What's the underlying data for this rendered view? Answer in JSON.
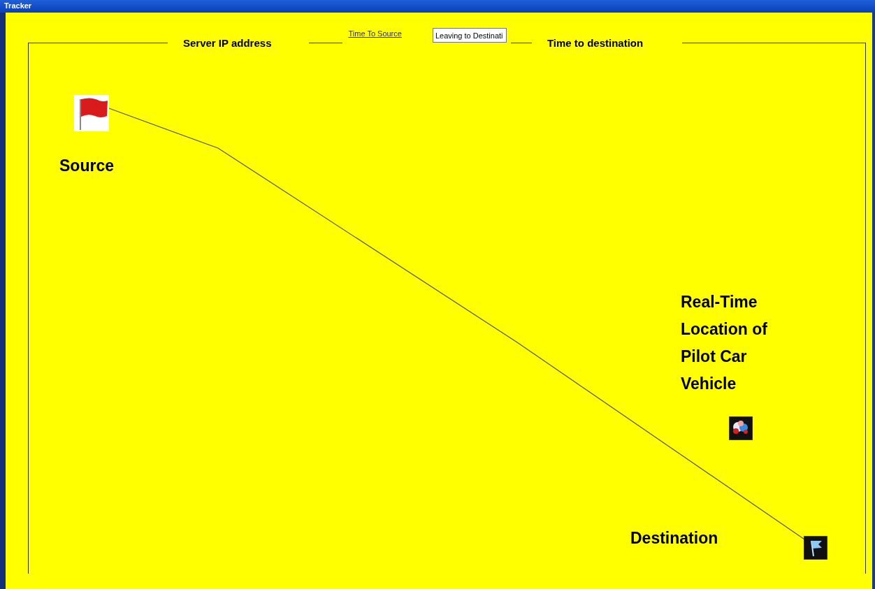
{
  "window": {
    "title": "Tracker"
  },
  "header": {
    "server_label": "Server IP address",
    "time_to_source_link": "Time To Source",
    "status_field": {
      "value": "Leaving to Destinati"
    },
    "time_to_destination_label": "Time to destination"
  },
  "map": {
    "markers": [
      {
        "kind": "source",
        "label": "Source"
      },
      {
        "kind": "vehicle",
        "label": "Real-Time Location of Pilot Car Vehicle"
      },
      {
        "kind": "destination",
        "label": "Destination"
      }
    ]
  }
}
